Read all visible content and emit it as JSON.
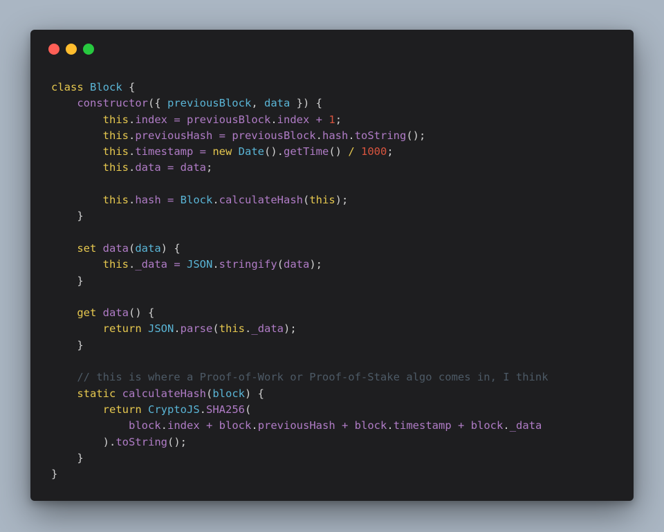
{
  "window": {
    "controls": {
      "close_color": "#ff5f56",
      "minimize_color": "#ffbd2e",
      "maximize_color": "#27c93f"
    }
  },
  "colors": {
    "keyword": "#e6c84f",
    "class_name": "#5ab5d6",
    "function": "#b07cc6",
    "number": "#d8543e",
    "punctuation": "#d0d0d0",
    "comment": "#4d5a66"
  },
  "code": {
    "lines": [
      [
        {
          "t": "class",
          "c": "kw"
        },
        {
          "t": " ",
          "c": "pn"
        },
        {
          "t": "Block",
          "c": "cls"
        },
        {
          "t": " {",
          "c": "pn"
        }
      ],
      [
        {
          "t": "    ",
          "c": "pn"
        },
        {
          "t": "constructor",
          "c": "fn"
        },
        {
          "t": "({ ",
          "c": "pn"
        },
        {
          "t": "previousBlock",
          "c": "prm"
        },
        {
          "t": ", ",
          "c": "pn"
        },
        {
          "t": "data",
          "c": "prm"
        },
        {
          "t": " }) {",
          "c": "pn"
        }
      ],
      [
        {
          "t": "        ",
          "c": "pn"
        },
        {
          "t": "this",
          "c": "kw"
        },
        {
          "t": ".",
          "c": "pn"
        },
        {
          "t": "index",
          "c": "fn"
        },
        {
          "t": " = ",
          "c": "fn"
        },
        {
          "t": "previousBlock",
          "c": "fn"
        },
        {
          "t": ".",
          "c": "pn"
        },
        {
          "t": "index",
          "c": "fn"
        },
        {
          "t": " + ",
          "c": "fn"
        },
        {
          "t": "1",
          "c": "num"
        },
        {
          "t": ";",
          "c": "pn"
        }
      ],
      [
        {
          "t": "        ",
          "c": "pn"
        },
        {
          "t": "this",
          "c": "kw"
        },
        {
          "t": ".",
          "c": "pn"
        },
        {
          "t": "previousHash",
          "c": "fn"
        },
        {
          "t": " = ",
          "c": "fn"
        },
        {
          "t": "previousBlock",
          "c": "fn"
        },
        {
          "t": ".",
          "c": "pn"
        },
        {
          "t": "hash",
          "c": "fn"
        },
        {
          "t": ".",
          "c": "pn"
        },
        {
          "t": "toString",
          "c": "fn"
        },
        {
          "t": "();",
          "c": "pn"
        }
      ],
      [
        {
          "t": "        ",
          "c": "pn"
        },
        {
          "t": "this",
          "c": "kw"
        },
        {
          "t": ".",
          "c": "pn"
        },
        {
          "t": "timestamp",
          "c": "fn"
        },
        {
          "t": " = ",
          "c": "fn"
        },
        {
          "t": "new",
          "c": "kw"
        },
        {
          "t": " ",
          "c": "pn"
        },
        {
          "t": "Date",
          "c": "cls"
        },
        {
          "t": "().",
          "c": "pn"
        },
        {
          "t": "getTime",
          "c": "fn"
        },
        {
          "t": "() ",
          "c": "pn"
        },
        {
          "t": "/",
          "c": "kw"
        },
        {
          "t": " ",
          "c": "pn"
        },
        {
          "t": "1000",
          "c": "num"
        },
        {
          "t": ";",
          "c": "pn"
        }
      ],
      [
        {
          "t": "        ",
          "c": "pn"
        },
        {
          "t": "this",
          "c": "kw"
        },
        {
          "t": ".",
          "c": "pn"
        },
        {
          "t": "data",
          "c": "fn"
        },
        {
          "t": " = ",
          "c": "fn"
        },
        {
          "t": "data",
          "c": "fn"
        },
        {
          "t": ";",
          "c": "pn"
        }
      ],
      [],
      [
        {
          "t": "        ",
          "c": "pn"
        },
        {
          "t": "this",
          "c": "kw"
        },
        {
          "t": ".",
          "c": "pn"
        },
        {
          "t": "hash",
          "c": "fn"
        },
        {
          "t": " = ",
          "c": "fn"
        },
        {
          "t": "Block",
          "c": "cls"
        },
        {
          "t": ".",
          "c": "pn"
        },
        {
          "t": "calculateHash",
          "c": "fn"
        },
        {
          "t": "(",
          "c": "pn"
        },
        {
          "t": "this",
          "c": "kw"
        },
        {
          "t": ");",
          "c": "pn"
        }
      ],
      [
        {
          "t": "    }",
          "c": "pn"
        }
      ],
      [],
      [
        {
          "t": "    ",
          "c": "pn"
        },
        {
          "t": "set",
          "c": "kw"
        },
        {
          "t": " ",
          "c": "pn"
        },
        {
          "t": "data",
          "c": "fn"
        },
        {
          "t": "(",
          "c": "pn"
        },
        {
          "t": "data",
          "c": "prm"
        },
        {
          "t": ") {",
          "c": "pn"
        }
      ],
      [
        {
          "t": "        ",
          "c": "pn"
        },
        {
          "t": "this",
          "c": "kw"
        },
        {
          "t": ".",
          "c": "pn"
        },
        {
          "t": "_data",
          "c": "fn"
        },
        {
          "t": " = ",
          "c": "fn"
        },
        {
          "t": "JSON",
          "c": "cls"
        },
        {
          "t": ".",
          "c": "pn"
        },
        {
          "t": "stringify",
          "c": "fn"
        },
        {
          "t": "(",
          "c": "pn"
        },
        {
          "t": "data",
          "c": "fn"
        },
        {
          "t": ");",
          "c": "pn"
        }
      ],
      [
        {
          "t": "    }",
          "c": "pn"
        }
      ],
      [],
      [
        {
          "t": "    ",
          "c": "pn"
        },
        {
          "t": "get",
          "c": "kw"
        },
        {
          "t": " ",
          "c": "pn"
        },
        {
          "t": "data",
          "c": "fn"
        },
        {
          "t": "() {",
          "c": "pn"
        }
      ],
      [
        {
          "t": "        ",
          "c": "pn"
        },
        {
          "t": "return",
          "c": "kw"
        },
        {
          "t": " ",
          "c": "pn"
        },
        {
          "t": "JSON",
          "c": "cls"
        },
        {
          "t": ".",
          "c": "pn"
        },
        {
          "t": "parse",
          "c": "fn"
        },
        {
          "t": "(",
          "c": "pn"
        },
        {
          "t": "this",
          "c": "kw"
        },
        {
          "t": ".",
          "c": "pn"
        },
        {
          "t": "_data",
          "c": "fn"
        },
        {
          "t": ");",
          "c": "pn"
        }
      ],
      [
        {
          "t": "    }",
          "c": "pn"
        }
      ],
      [],
      [
        {
          "t": "    ",
          "c": "pn"
        },
        {
          "t": "// this is where a Proof-of-Work or Proof-of-Stake algo comes in, I think",
          "c": "cmt"
        }
      ],
      [
        {
          "t": "    ",
          "c": "pn"
        },
        {
          "t": "static",
          "c": "kw"
        },
        {
          "t": " ",
          "c": "pn"
        },
        {
          "t": "calculateHash",
          "c": "fn"
        },
        {
          "t": "(",
          "c": "pn"
        },
        {
          "t": "block",
          "c": "prm"
        },
        {
          "t": ") {",
          "c": "pn"
        }
      ],
      [
        {
          "t": "        ",
          "c": "pn"
        },
        {
          "t": "return",
          "c": "kw"
        },
        {
          "t": " ",
          "c": "pn"
        },
        {
          "t": "CryptoJS",
          "c": "cls"
        },
        {
          "t": ".",
          "c": "pn"
        },
        {
          "t": "SHA256",
          "c": "fn"
        },
        {
          "t": "(",
          "c": "pn"
        }
      ],
      [
        {
          "t": "            ",
          "c": "pn"
        },
        {
          "t": "block",
          "c": "fn"
        },
        {
          "t": ".",
          "c": "pn"
        },
        {
          "t": "index",
          "c": "fn"
        },
        {
          "t": " + ",
          "c": "fn"
        },
        {
          "t": "block",
          "c": "fn"
        },
        {
          "t": ".",
          "c": "pn"
        },
        {
          "t": "previousHash",
          "c": "fn"
        },
        {
          "t": " + ",
          "c": "fn"
        },
        {
          "t": "block",
          "c": "fn"
        },
        {
          "t": ".",
          "c": "pn"
        },
        {
          "t": "timestamp",
          "c": "fn"
        },
        {
          "t": " + ",
          "c": "fn"
        },
        {
          "t": "block",
          "c": "fn"
        },
        {
          "t": ".",
          "c": "pn"
        },
        {
          "t": "_data",
          "c": "fn"
        }
      ],
      [
        {
          "t": "        ).",
          "c": "pn"
        },
        {
          "t": "toString",
          "c": "fn"
        },
        {
          "t": "();",
          "c": "pn"
        }
      ],
      [
        {
          "t": "    }",
          "c": "pn"
        }
      ],
      [
        {
          "t": "}",
          "c": "pn"
        }
      ]
    ]
  }
}
